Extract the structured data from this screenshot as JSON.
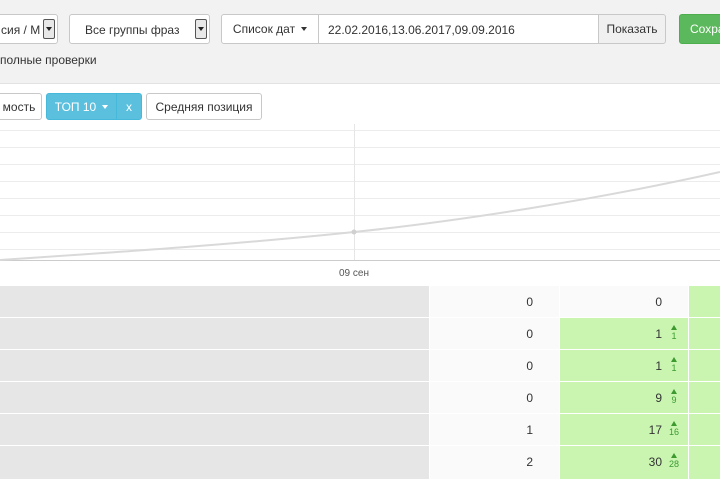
{
  "toolbar": {
    "region_value": "сия / М",
    "group_value": "Все группы фраз",
    "date_mode_label": "Список дат",
    "dates_value": "22.02.2016,13.06.2017,09.09.2016",
    "show_button": "Показать",
    "save_button": "Сохра"
  },
  "checkbox_label": "полные проверки",
  "chart_tabs": {
    "visibility": "мость",
    "top": "ТОП 10",
    "close": "x",
    "avg_position": "Средняя позиция"
  },
  "chart_data": {
    "type": "line",
    "x": [
      "09 сен"
    ],
    "series": [
      {
        "values": []
      }
    ],
    "grid": true,
    "legend": "none"
  },
  "table": {
    "rows": [
      {
        "col1": "0",
        "col2": "0",
        "delta": "",
        "highlight": false
      },
      {
        "col1": "0",
        "col2": "1",
        "delta": "1",
        "highlight": true
      },
      {
        "col1": "0",
        "col2": "1",
        "delta": "1",
        "highlight": true
      },
      {
        "col1": "0",
        "col2": "9",
        "delta": "9",
        "highlight": true
      },
      {
        "col1": "1",
        "col2": "17",
        "delta": "16",
        "highlight": true
      },
      {
        "col1": "2",
        "col2": "30",
        "delta": "28",
        "highlight": true
      }
    ]
  },
  "colors": {
    "info_blue": "#5bc0de",
    "success_green": "#5cb85c",
    "positive_cell": "#c9f5b1",
    "delta_green": "#3c9a2f"
  }
}
